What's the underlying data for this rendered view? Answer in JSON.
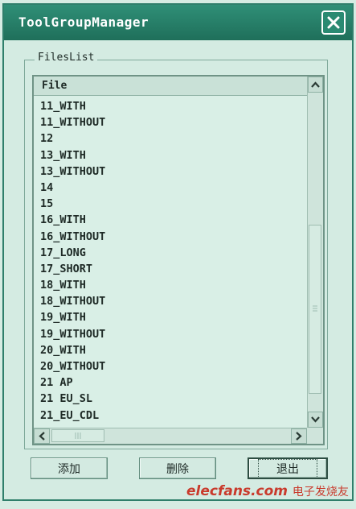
{
  "window": {
    "title": "ToolGroupManager"
  },
  "groupbox": {
    "label": "FilesList"
  },
  "list": {
    "column_header": "File",
    "items": [
      "11_WITH",
      "11_WITHOUT",
      "12",
      "13_WITH",
      "13_WITHOUT",
      "14",
      "15",
      "16_WITH",
      "16_WITHOUT",
      "17_LONG",
      "17_SHORT",
      "18_WITH",
      "18_WITHOUT",
      "19_WITH",
      "19_WITHOUT",
      "20_WITH",
      "20_WITHOUT",
      "21 AP",
      "21 EU_SL",
      "21_EU_CDL"
    ]
  },
  "buttons": {
    "add": "添加",
    "delete": "删除",
    "exit": "退出"
  },
  "watermark": {
    "brand": "elecfans",
    "domain": ".com",
    "cn": "电子发烧友"
  },
  "colors": {
    "titlebar": "#2f8f77",
    "window_bg": "#d4ebe2",
    "list_bg": "#d9efe6",
    "watermark": "#c93a2c"
  },
  "icons": {
    "close": "close-icon",
    "scroll_up": "chevron-up-icon",
    "scroll_down": "chevron-down-icon",
    "scroll_left": "chevron-left-icon",
    "scroll_right": "chevron-right-icon"
  }
}
